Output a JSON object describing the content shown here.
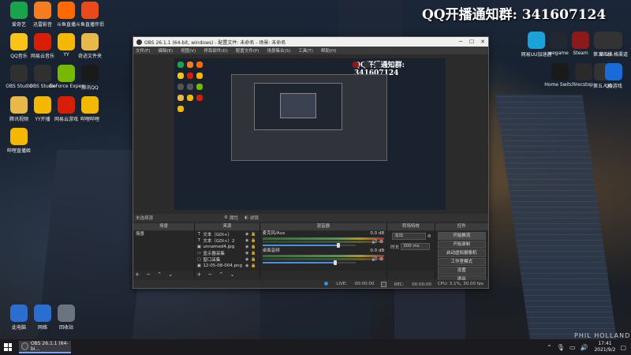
{
  "watermark": "QQ开播通知群: 341607124",
  "credit": "PHIL HOLLAND",
  "desktop_icons_left": [
    {
      "label": "爱奇艺",
      "icon": "play-app-icon",
      "color": "#19a34a"
    },
    {
      "label": "迅雷影音",
      "icon": "thunder-player-icon",
      "color": "#f47d20"
    },
    {
      "label": "斗鱼直播",
      "icon": "douyu-icon",
      "color": "#ff6a00"
    },
    {
      "label": "斗鱼直播伴侣",
      "icon": "douyu-companion-icon",
      "color": "#e84a1a"
    },
    {
      "label": "QQ音乐",
      "icon": "qq-music-icon",
      "color": "#f9c318"
    },
    {
      "label": "网易云音乐",
      "icon": "netease-music-icon",
      "color": "#d81e06"
    },
    {
      "label": "YY",
      "icon": "yy-icon",
      "color": "#f5b800"
    },
    {
      "label": "奇迹文件夹",
      "icon": "folder-icon",
      "color": "#e8b84a"
    },
    {
      "label": "OBS Studio",
      "icon": "obs-icon",
      "color": "#303030"
    },
    {
      "label": "OBS Studio",
      "icon": "obs-icon-2",
      "color": "#303030"
    },
    {
      "label": "GeForce Experience",
      "icon": "geforce-icon",
      "color": "#76b900"
    },
    {
      "label": "腾讯QQ",
      "icon": "qq-penguin-icon",
      "color": "#1a1a1a"
    },
    {
      "label": "腾讯视频",
      "icon": "folder-icon-2",
      "color": "#e8b84a"
    },
    {
      "label": "YY开播",
      "icon": "yy-live-icon",
      "color": "#f5b800"
    },
    {
      "label": "网易云游戏",
      "icon": "netease-game-icon",
      "color": "#d81e06"
    },
    {
      "label": "哔哩哔哩",
      "icon": "bili-icon",
      "color": "#f5b800"
    },
    {
      "label": "哔哩直播姬",
      "icon": "bili-live-icon",
      "color": "#f5b800"
    }
  ],
  "desktop_icons_right": [
    {
      "label": "网易UU加速器",
      "icon": "uu-accelerator-icon",
      "color": "#1aa3d8"
    },
    {
      "label": "wegame",
      "icon": "wegame-icon",
      "color": "#222831"
    },
    {
      "label": "Steam",
      "icon": "steam-icon",
      "color": "#8b1a1a"
    },
    {
      "label": "第五人格",
      "icon": "game-icon-1",
      "color": "#333"
    },
    {
      "label": "第五人格渠道",
      "icon": "game-icon-2",
      "color": "#333"
    },
    {
      "label": "Home Switch",
      "icon": "home-switch-icon",
      "color": "#1a1a1a"
    },
    {
      "label": "irecstop",
      "icon": "rec-icon",
      "color": "#2a2a2a"
    },
    {
      "label": "第五人格",
      "icon": "game-icon-3",
      "color": "#333"
    },
    {
      "label": "QQ游戏",
      "icon": "qq-game-icon",
      "color": "#1a6bd8"
    }
  ],
  "desktop_icons_bottom": [
    {
      "label": "此电脑",
      "icon": "computer-icon",
      "color": "#2a6fd0"
    },
    {
      "label": "网络",
      "icon": "network-icon",
      "color": "#2a6fd0"
    },
    {
      "label": "回收站",
      "icon": "recycle-bin-icon",
      "color": "#6a7480"
    }
  ],
  "obs": {
    "title": "OBS 26.1.1 (64-bit, windows) - 配置文件: 未命名 - 场景: 未命名",
    "menu": [
      "文件(F)",
      "编辑(E)",
      "视图(V)",
      "停靠部件(D)",
      "配置文件(P)",
      "场景集合(S)",
      "工具(T)",
      "帮助(H)"
    ],
    "no_source": "未选择源",
    "properties": "属性",
    "filters": "滤镜",
    "docks": {
      "scenes": "场景",
      "sources": "来源",
      "mixer": "混音器",
      "transitions": "转场特效",
      "controls": "控件"
    },
    "scenes": [
      "场景"
    ],
    "sources": [
      "文本（GDI+）",
      "文本（GDI+）2",
      "unnamed4.jpg",
      "显示器采集",
      "窗口采集",
      "12-05-08-004.png"
    ],
    "mixer": [
      {
        "name": "麦克风/Aux",
        "db": "0.0 dB",
        "level": 0.82
      },
      {
        "name": "桌面音频",
        "db": "0.0 dB",
        "level": 0.78
      }
    ],
    "transition": {
      "type": "淡出",
      "duration_label": "时长",
      "duration": "300 ms"
    },
    "controls": [
      "开始推流",
      "开始录制",
      "启动虚拟摄像机",
      "工作室模式",
      "设置",
      "退出"
    ],
    "status": {
      "live_label": "LIVE:",
      "live_time": "00:00:00",
      "rec_label": "REC:",
      "rec_time": "00:00:00",
      "cpu": "CPU: 3.1%, 30.00 fps"
    },
    "foot_controls": "+ − ⌃ ⌄"
  },
  "taskbar": {
    "item_label": "OBS 26.1.1 (64-bi...",
    "time": "17:41",
    "date": "2021/9/2"
  }
}
